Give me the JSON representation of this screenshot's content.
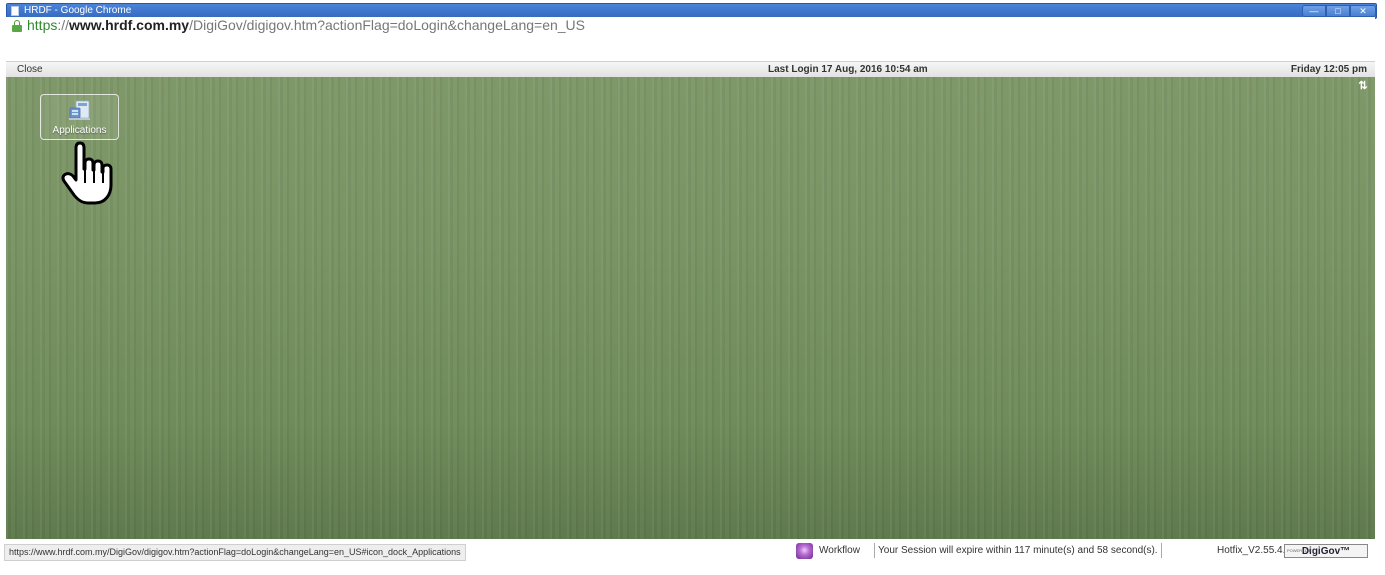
{
  "window": {
    "title": "HRDF - Google Chrome",
    "controls": {
      "minimize": "—",
      "maximize": "□",
      "close": "✕"
    }
  },
  "urlbar": {
    "scheme": "https",
    "separator": "://",
    "host": "www.hrdf.com.my",
    "path": "/DigiGov/digigov.htm?actionFlag=doLogin&changeLang=en_US",
    "icon": "lock-icon",
    "secure_color": "#2f8a2f"
  },
  "header": {
    "close_label": "Close",
    "last_login": "Last Login 17 Aug, 2016 10:54 am",
    "clock": "Friday 12:05 pm"
  },
  "desktop": {
    "toggle_icon": "⇅",
    "icons": [
      {
        "label": "Applications",
        "icon": "applications-icon"
      }
    ],
    "background_color": "#7a9465"
  },
  "statusbar": {
    "hover_url": "https://www.hrdf.com.my/DigiGov/digigov.htm?actionFlag=doLogin&changeLang=en_US#icon_dock_Applications",
    "workflow_label": "Workflow",
    "session_text": "Your Session will expire within 117 minute(s) and 58 second(s).",
    "hotfix": "Hotfix_V2.55.4.1",
    "brand": "DigiGov™",
    "brand_small": "POWERED BY"
  }
}
